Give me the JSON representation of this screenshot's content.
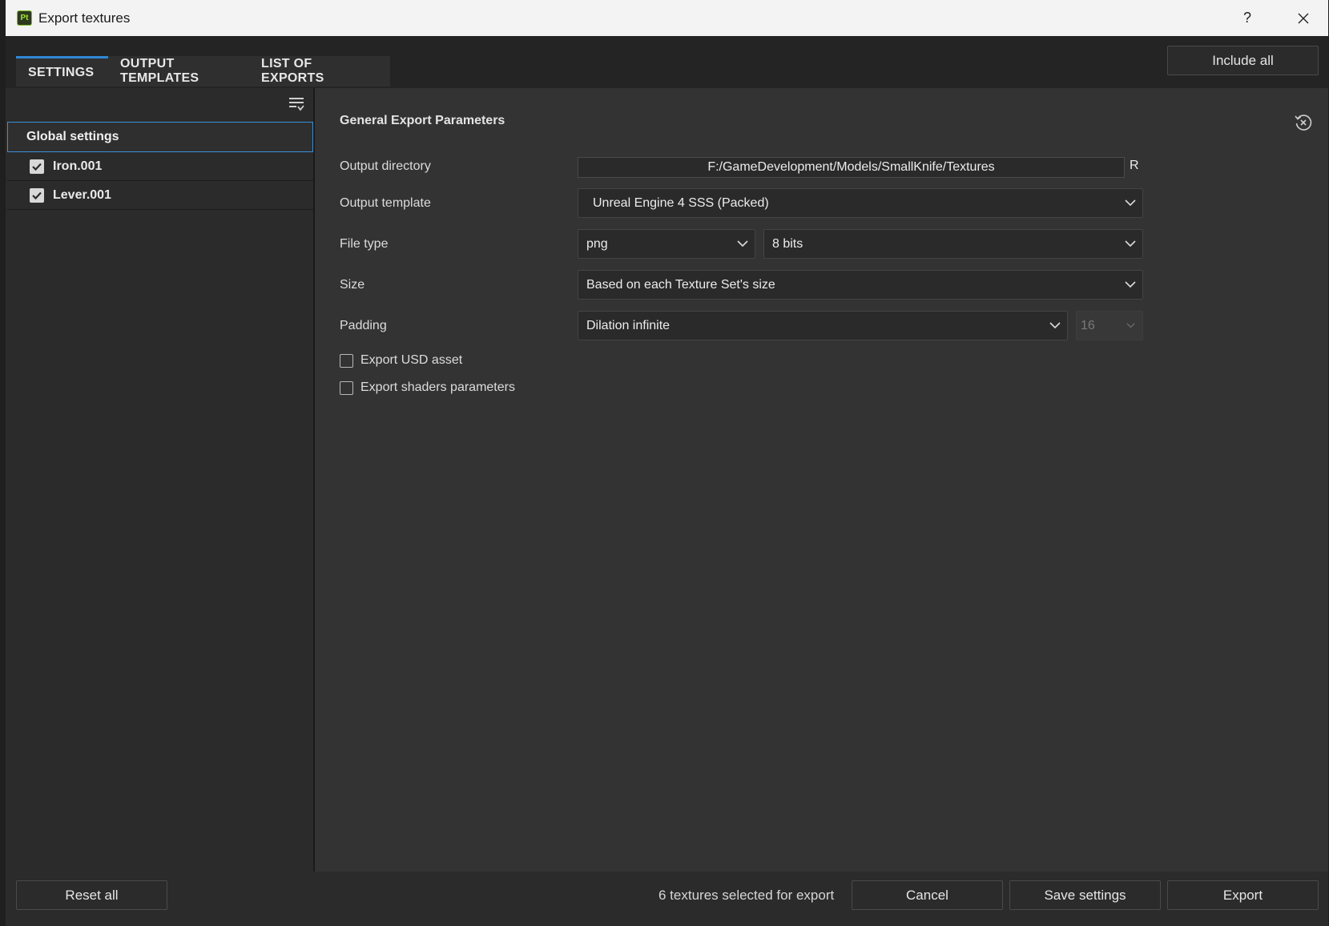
{
  "window": {
    "title": "Export textures",
    "app_badge": "Pt",
    "help_label": "?"
  },
  "tabs": [
    {
      "label": "SETTINGS",
      "active": true
    },
    {
      "label": "OUTPUT TEMPLATES",
      "active": false
    },
    {
      "label": "LIST OF EXPORTS",
      "active": false
    }
  ],
  "toolbar": {
    "include_all_label": "Include all"
  },
  "sidebar": {
    "global_label": "Global settings",
    "items": [
      {
        "label": "Iron.001",
        "checked": true
      },
      {
        "label": "Lever.001",
        "checked": true
      }
    ]
  },
  "params": {
    "section_title": "General Export Parameters",
    "output_directory": {
      "label": "Output directory",
      "value": "F:/GameDevelopment/Models/SmallKnife/Textures",
      "button": "R"
    },
    "output_template": {
      "label": "Output template",
      "value": "Unreal Engine 4 SSS (Packed)"
    },
    "file_type": {
      "label": "File type",
      "format": "png",
      "bit_depth": "8 bits"
    },
    "size": {
      "label": "Size",
      "value": "Based on each Texture Set's size"
    },
    "padding": {
      "label": "Padding",
      "value": "Dilation infinite",
      "distance": "16",
      "distance_enabled": false
    },
    "export_usd": {
      "label": "Export USD asset",
      "checked": false
    },
    "export_shaders": {
      "label": "Export shaders parameters",
      "checked": false
    }
  },
  "footer": {
    "reset_all_label": "Reset all",
    "status": "6 textures selected for export",
    "cancel_label": "Cancel",
    "save_label": "Save settings",
    "export_label": "Export"
  },
  "colors": {
    "accent": "#2f88d6",
    "panel_bg": "#333333",
    "sidebar_bg": "#2b2b2b",
    "titlebar_bg": "#f3f3f3"
  }
}
